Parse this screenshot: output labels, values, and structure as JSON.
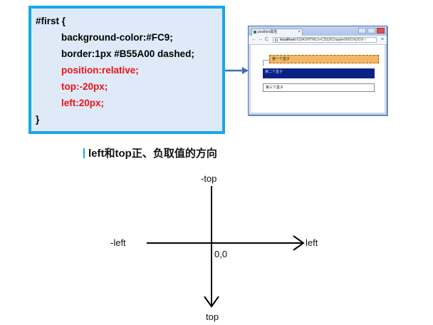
{
  "code": {
    "selector_line": "#first {",
    "lines": [
      "background-color:#FC9;",
      "border:1px #B55A00 dashed;",
      "position:relative;",
      "top:-20px;",
      "left:20px;"
    ],
    "closing": "}",
    "highlight_color": "#ee1111"
  },
  "browser": {
    "tab_title": "position属性",
    "tab_close": "×",
    "address_host": "localhost",
    "address_path": ":63342/HTML5+CSS3/Chapter06/01%20冷☆",
    "menu_glyph": "≡",
    "boxes": {
      "first": "第一个盒子",
      "second": "第二个盒子",
      "third": "第三个盒子"
    }
  },
  "heading": "left和top正、负取值的方向",
  "axes": {
    "neg_top": "-top",
    "top": "top",
    "neg_left": "-left",
    "left": "left",
    "origin": "0,0"
  }
}
